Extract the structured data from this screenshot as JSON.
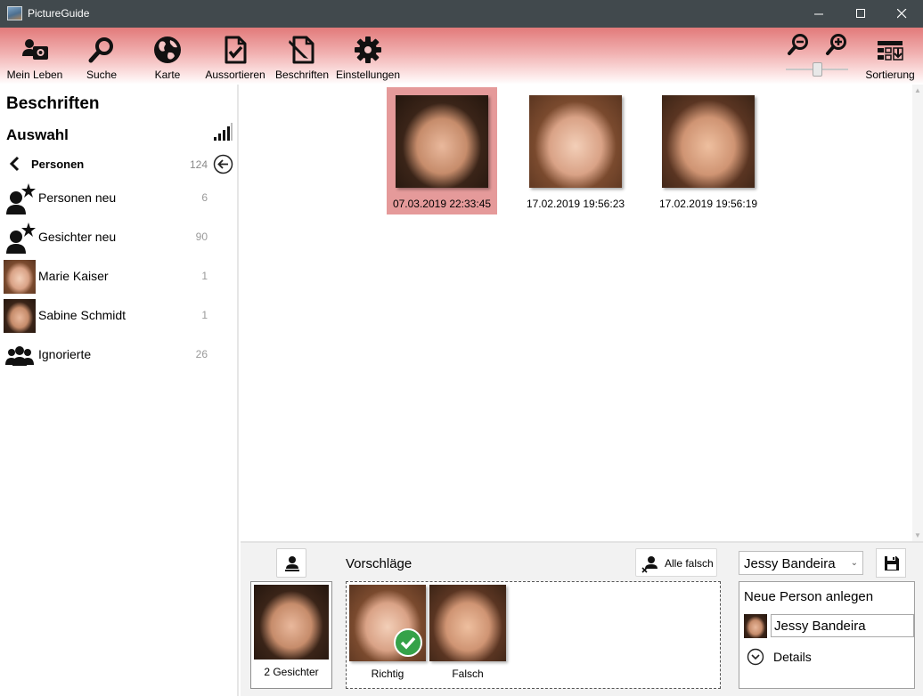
{
  "window": {
    "title": "PictureGuide",
    "minimize": "—",
    "maximize": "☐",
    "close": "✕"
  },
  "toolbar": {
    "items": [
      {
        "label": "Mein Leben",
        "icon": "people-photo-icon"
      },
      {
        "label": "Suche",
        "icon": "search-icon"
      },
      {
        "label": "Karte",
        "icon": "globe-icon"
      },
      {
        "label": "Aussortieren",
        "icon": "document-check-icon"
      },
      {
        "label": "Beschriften",
        "icon": "document-edit-icon"
      },
      {
        "label": "Einstellungen",
        "icon": "gear-icon"
      }
    ],
    "zoom_out_icon": "zoom-out-icon",
    "zoom_in_icon": "zoom-in-icon",
    "zoom_level": 0.5,
    "sort_label": "Sortierung"
  },
  "sidebar": {
    "title": "Beschriften",
    "subtitle": "Auswahl",
    "group": {
      "label": "Personen",
      "count": "124"
    },
    "items": [
      {
        "label": "Personen neu",
        "count": "6",
        "icon": "person-star-icon"
      },
      {
        "label": "Gesichter neu",
        "count": "90",
        "icon": "person-star-icon"
      },
      {
        "label": "Marie Kaiser",
        "count": "1",
        "icon": "avatar"
      },
      {
        "label": "Sabine Schmidt",
        "count": "1",
        "icon": "avatar"
      },
      {
        "label": "Ignorierte",
        "count": "26",
        "icon": "group-icon"
      }
    ]
  },
  "gallery": {
    "photos": [
      {
        "date": "07.03.2019 22:33:45",
        "selected": true
      },
      {
        "date": "17.02.2019 19:56:23",
        "selected": false
      },
      {
        "date": "17.02.2019 19:56:19",
        "selected": false
      }
    ]
  },
  "suggestions": {
    "title": "Vorschläge",
    "all_false_label": "Alle falsch",
    "group_caption": "2 Gesichter",
    "items": [
      {
        "label": "Richtig",
        "checked": true
      },
      {
        "label": "Falsch",
        "checked": false
      }
    ]
  },
  "assign": {
    "selected_person": "Jessy Bandeira",
    "new_person_label": "Neue Person anlegen",
    "name_value": "Jessy Bandeira",
    "details_label": "Details"
  },
  "colors": {
    "accent": "#e27a7a",
    "selected": "#e59a9a",
    "titlebar": "#41494d",
    "check": "#35a249"
  }
}
